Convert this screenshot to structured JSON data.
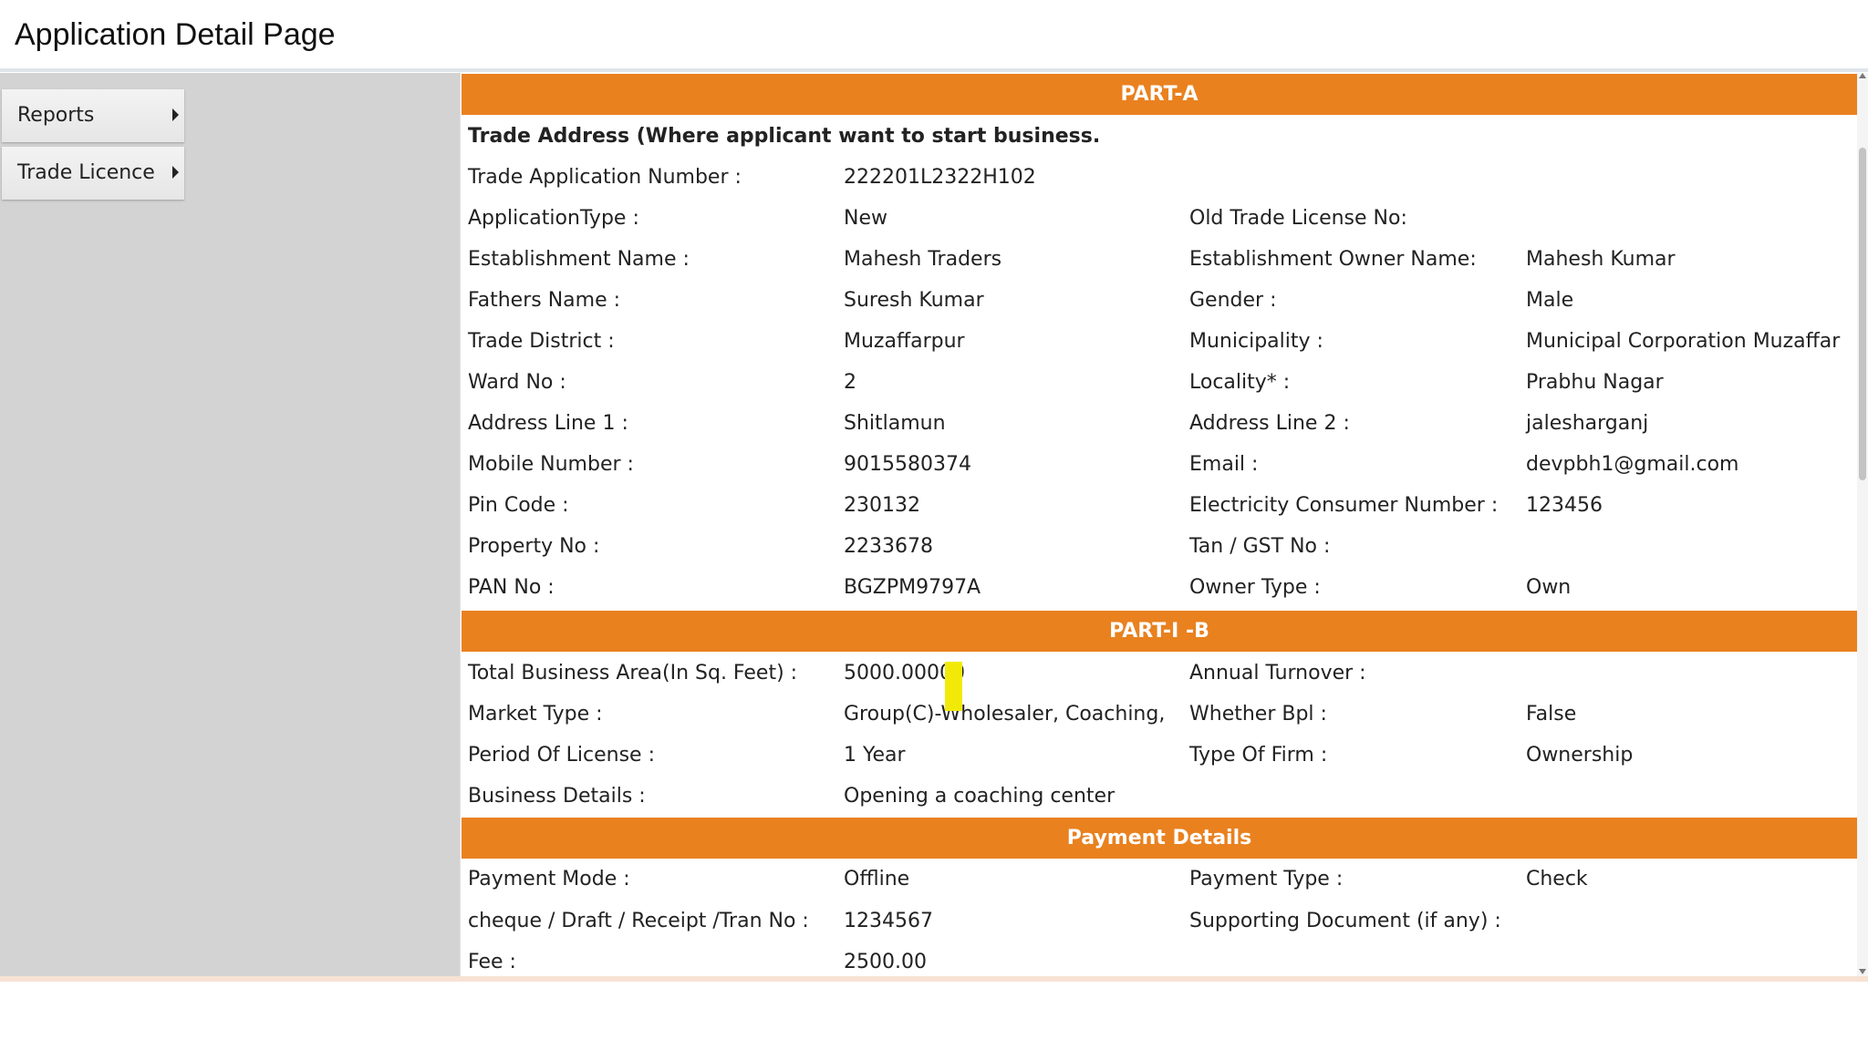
{
  "page_title": "Application Detail Page",
  "sidebar": {
    "items": [
      {
        "label": "Reports",
        "icon": "caret-right-icon"
      },
      {
        "label": "Trade Licence",
        "icon": "caret-right-icon"
      }
    ]
  },
  "colors": {
    "section_header": "#e9811f",
    "sidebar_bg": "#d3d3d3",
    "highlight": "#f1ea09"
  },
  "part_a": {
    "header": "PART-A",
    "heading": "Trade Address (Where applicant want to start business.",
    "rows": [
      {
        "l1": "Trade Application Number :",
        "v1": "222201L2322H102",
        "l2": "",
        "v2": ""
      },
      {
        "l1": "ApplicationType :",
        "v1": "New",
        "l2": "Old Trade License No:",
        "v2": ""
      },
      {
        "l1": "Establishment Name :",
        "v1": "Mahesh Traders",
        "l2": "Establishment Owner Name:",
        "v2": "Mahesh Kumar"
      },
      {
        "l1": "Fathers Name :",
        "v1": "Suresh Kumar",
        "l2": "Gender :",
        "v2": "Male"
      },
      {
        "l1": "Trade District :",
        "v1": "Muzaffarpur",
        "l2": "Municipality :",
        "v2": "Municipal Corporation Muzaffar"
      },
      {
        "l1": "Ward No :",
        "v1": "2",
        "l2": "Locality* :",
        "v2": "Prabhu Nagar"
      },
      {
        "l1": "Address Line 1 :",
        "v1": "Shitlamun",
        "l2": "Address Line 2 :",
        "v2": "jalesharganj"
      },
      {
        "l1": "Mobile Number :",
        "v1": "9015580374",
        "l2": "Email :",
        "v2": "devpbh1@gmail.com"
      },
      {
        "l1": "Pin Code :",
        "v1": "230132",
        "l2": "Electricity Consumer Number :",
        "v2": "123456"
      },
      {
        "l1": "Property No :",
        "v1": "2233678",
        "l2": "Tan / GST No :",
        "v2": ""
      },
      {
        "l1": "PAN No :",
        "v1": "BGZPM9797A",
        "l2": "Owner Type :",
        "v2": "Own"
      }
    ]
  },
  "part_b": {
    "header": "PART-I -B",
    "rows": [
      {
        "l1": "Total Business Area(In Sq. Feet) :",
        "v1": "5000.00000",
        "l2": "Annual Turnover :",
        "v2": ""
      },
      {
        "l1": "Market Type :",
        "v1": "Group(C)-Wholesaler, Coaching,",
        "l2": "Whether Bpl :",
        "v2": "False"
      },
      {
        "l1": "Period Of License :",
        "v1": "1 Year",
        "l2": "Type Of Firm :",
        "v2": "Ownership"
      },
      {
        "l1": "Business Details :",
        "v1": "Opening a coaching center",
        "l2": "",
        "v2": ""
      }
    ]
  },
  "payment": {
    "header": "Payment Details",
    "rows": [
      {
        "l1": "Payment Mode :",
        "v1": "Offline",
        "l2": "Payment Type :",
        "v2": "Check"
      },
      {
        "l1": "cheque / Draft / Receipt /Tran No :",
        "v1": "1234567",
        "l2": "Supporting Document (if any) :",
        "v2": ""
      },
      {
        "l1": "Fee :",
        "v1": "2500.00",
        "l2": "",
        "v2": ""
      }
    ]
  }
}
